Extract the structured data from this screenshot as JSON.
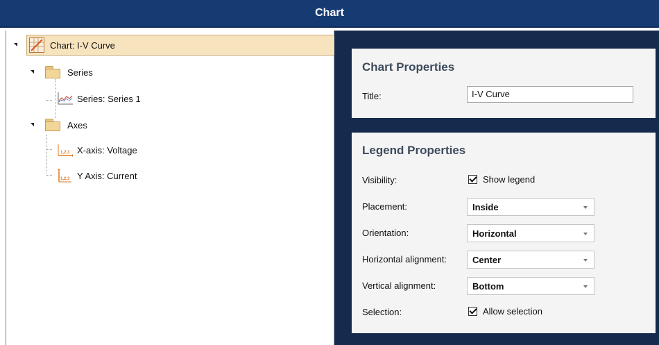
{
  "window": {
    "title": "Chart"
  },
  "tree": {
    "root": {
      "label": "Chart: I-V Curve"
    },
    "series_folder": {
      "label": "Series"
    },
    "series_item": {
      "label": "Series: Series 1"
    },
    "axes_folder": {
      "label": "Axes"
    },
    "x_axis_item": {
      "label": "X-axis: Voltage"
    },
    "y_axis_item": {
      "label": "Y Axis: Current"
    },
    "axis_icon_text": "1,2,3"
  },
  "chart_properties": {
    "heading": "Chart Properties",
    "title_label": "Title:",
    "title_value": "I-V Curve"
  },
  "legend_properties": {
    "heading": "Legend Properties",
    "visibility_label": "Visibility:",
    "visibility_checkbox": {
      "label": "Show legend",
      "checked": true
    },
    "placement_label": "Placement:",
    "placement_value": "Inside",
    "orientation_label": "Orientation:",
    "orientation_value": "Horizontal",
    "horizontal_alignment_label": "Horizontal alignment:",
    "horizontal_alignment_value": "Center",
    "vertical_alignment_label": "Vertical alignment:",
    "vertical_alignment_value": "Bottom",
    "selection_label": "Selection:",
    "selection_checkbox": {
      "label": "Allow selection",
      "checked": true
    }
  },
  "colors": {
    "title_bar": "#163b73",
    "properties_background": "#152a4d",
    "card_background": "#f4f4f4",
    "selected_row": "#f7e3bd",
    "axis_icon_accent": "#e07a1f"
  }
}
